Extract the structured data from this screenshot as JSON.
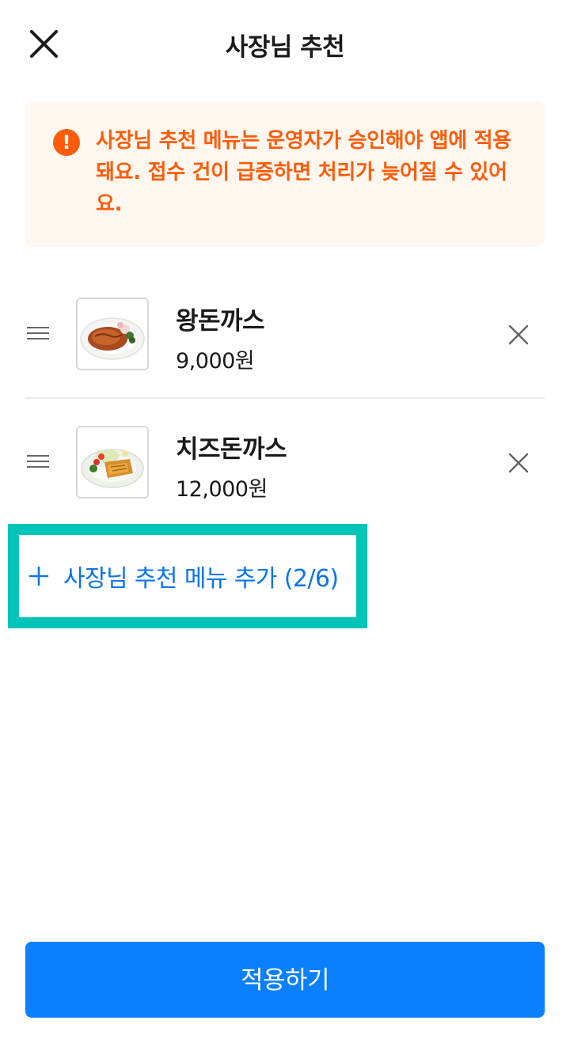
{
  "header": {
    "title": "사장님 추천",
    "close_icon": "close-icon"
  },
  "notice": {
    "icon": "exclamation-icon",
    "icon_glyph": "!",
    "text": "사장님 추천 메뉴는 운영자가 승인해야 앱에 적용돼요. 접수 건이 급증하면 처리가 늦어질 수 있어요.",
    "color": "#ff5c0a",
    "background": "#fff8f1"
  },
  "menu": {
    "items": [
      {
        "name": "왕돈까스",
        "price": "9,000원",
        "image": "pork-cutlet-photo"
      },
      {
        "name": "치즈돈까스",
        "price": "12,000원",
        "image": "cheese-cutlet-photo"
      }
    ]
  },
  "add_button": {
    "label": "사장님 추천 메뉴 추가 (2/6)",
    "icon": "plus-icon",
    "color": "#0a74ee",
    "highlight_color": "#00c4b8"
  },
  "apply_button": {
    "label": "적용하기",
    "color": "#0a80ff"
  }
}
